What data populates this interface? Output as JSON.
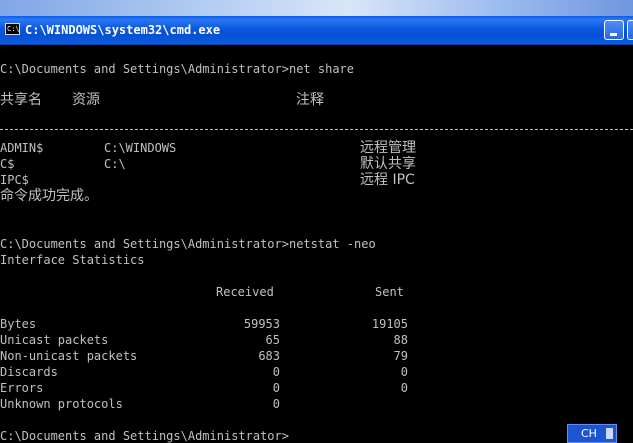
{
  "window": {
    "title": "C:\\WINDOWS\\system32\\cmd.exe",
    "icon_text": "C:\\"
  },
  "console": {
    "prompt1": "C:\\Documents and Settings\\Administrator>net share",
    "share_header": {
      "name": "共享名",
      "resource": "资源",
      "remark": "注释"
    },
    "shares": [
      {
        "name": "ADMIN$",
        "resource": "C:\\WINDOWS",
        "remark": "远程管理"
      },
      {
        "name": "C$",
        "resource": "C:\\",
        "remark": "默认共享"
      },
      {
        "name": "IPC$",
        "resource": "",
        "remark": "远程 IPC"
      }
    ],
    "share_result": "命令成功完成。",
    "prompt2": "C:\\Documents and Settings\\Administrator>netstat -neo",
    "stats_title": "Interface Statistics",
    "stats_header": {
      "received": "Received",
      "sent": "Sent"
    },
    "stats": [
      {
        "label": "Bytes",
        "received": "59953",
        "sent": "19105"
      },
      {
        "label": "Unicast packets",
        "received": "65",
        "sent": "88"
      },
      {
        "label": "Non-unicast packets",
        "received": "683",
        "sent": "79"
      },
      {
        "label": "Discards",
        "received": "0",
        "sent": "0"
      },
      {
        "label": "Errors",
        "received": "0",
        "sent": "0"
      },
      {
        "label": "Unknown protocols",
        "received": "0",
        "sent": ""
      }
    ],
    "prompt3": "C:\\Documents and Settings\\Administrator>"
  },
  "taskbar": {
    "language": "CH"
  },
  "colors": {
    "console_bg": "#000000",
    "console_text": "#c0c0c0",
    "titlebar": "#0a58df"
  }
}
